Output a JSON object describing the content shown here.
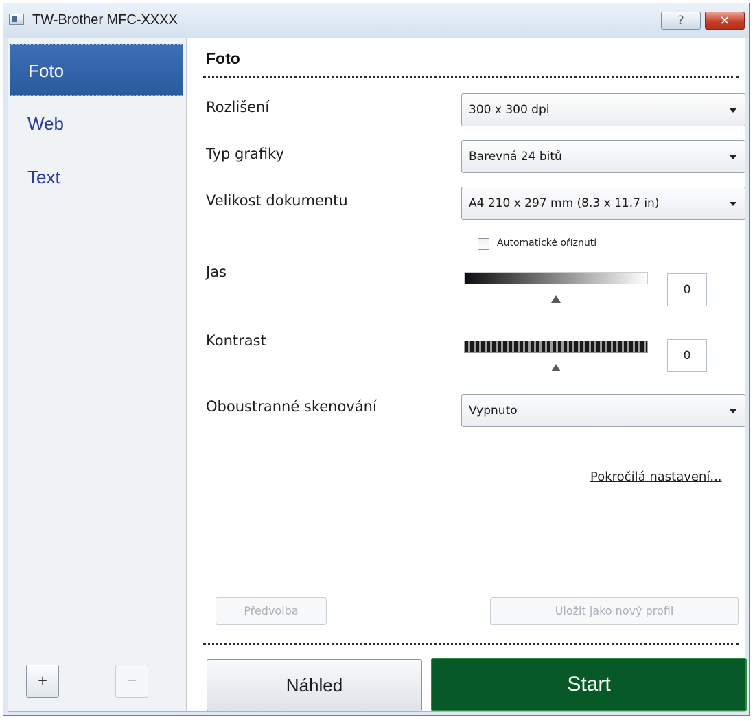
{
  "window": {
    "title": "TW-Brother MFC-XXXX",
    "help_label": "?",
    "close_label": "✕"
  },
  "sidebar": {
    "items": [
      {
        "label": "Foto",
        "active": true
      },
      {
        "label": "Web",
        "active": false
      },
      {
        "label": "Text",
        "active": false
      }
    ],
    "add_label": "+",
    "remove_label": "−"
  },
  "main": {
    "heading": "Foto",
    "resolution": {
      "label": "Rozlišení",
      "value": "300 x 300 dpi"
    },
    "graphic_type": {
      "label": "Typ grafiky",
      "value": "Barevná 24 bitů"
    },
    "document_size": {
      "label": "Velikost dokumentu",
      "value": "A4 210 x 297 mm (8.3 x 11.7 in)"
    },
    "auto_crop": {
      "label": "Automatické oříznutí",
      "checked": false
    },
    "brightness": {
      "label": "Jas",
      "value": "0"
    },
    "contrast": {
      "label": "Kontrast",
      "value": "0"
    },
    "duplex": {
      "label": "Oboustranné skenování",
      "value": "Vypnuto"
    },
    "advanced_link": "Pokročilá nastavení...",
    "preset_button": "Předvolba",
    "save_profile_button": "Uložit jako nový profil",
    "preview_button": "Náhled",
    "start_button": "Start"
  },
  "colors": {
    "start_bg": "#075a27",
    "sidebar_active": "#2a5a9e",
    "sidebar_text": "#2c3aa0"
  }
}
